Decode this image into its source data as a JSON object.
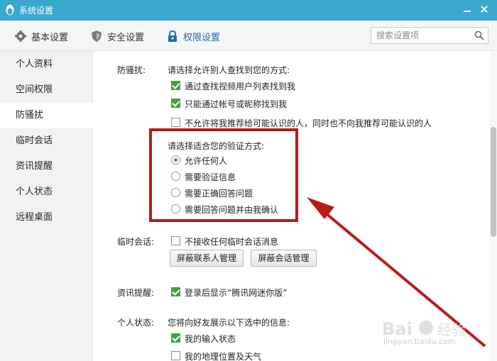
{
  "window": {
    "title": "系统设置"
  },
  "tabs": [
    {
      "label": "基本设置",
      "icon": "gear-icon"
    },
    {
      "label": "安全设置",
      "icon": "shield-icon"
    },
    {
      "label": "权限设置",
      "icon": "lock-icon",
      "active": true
    }
  ],
  "search": {
    "placeholder": "搜索设置项"
  },
  "sidebar": {
    "items": [
      {
        "label": "个人资料"
      },
      {
        "label": "空间权限"
      },
      {
        "label": "防骚扰",
        "active": true
      },
      {
        "label": "临时会话"
      },
      {
        "label": "资讯提醒"
      },
      {
        "label": "个人状态"
      },
      {
        "label": "远程桌面"
      }
    ]
  },
  "anti_harass": {
    "label": "防骚扰:",
    "prompt": "请选择允许别人查找到您的方式:",
    "options": [
      {
        "label": "通过查找视频用户列表找到我",
        "checked": true
      },
      {
        "label": "只能通过帐号或昵称找到我",
        "checked": true
      },
      {
        "label": "不允许将我推荐给可能认识的人，同时也不向我推荐可能认识的人",
        "checked": false
      }
    ],
    "verify_prompt": "请选择适合您的验证方式:",
    "verify_options": [
      {
        "label": "允许任何人",
        "selected": true
      },
      {
        "label": "需要验证信息",
        "selected": false
      },
      {
        "label": "需要正确回答问题",
        "selected": false
      },
      {
        "label": "需要回答问题并由我确认",
        "selected": false
      }
    ]
  },
  "temp_session": {
    "label": "临时会话:",
    "option": {
      "label": "不接收任何临时会话消息",
      "checked": false
    },
    "buttons": [
      "屏蔽联系人管理",
      "屏蔽会话管理"
    ]
  },
  "news": {
    "label": "资讯提醒:",
    "option": {
      "label": "登录后显示“腾讯网迷你版”",
      "checked": true
    }
  },
  "status": {
    "label": "个人状态:",
    "prompt": "您将向好友展示以下选中的信息:",
    "options": [
      {
        "label": "我的输入状态",
        "checked": true
      },
      {
        "label": "我的地理位置及天气",
        "checked": false
      }
    ]
  },
  "colors": {
    "titlebar": "#3aa8cf",
    "check_green": "#41a047",
    "annotation_red": "#b71c1c",
    "active_tab_blue": "#1b6fb6"
  },
  "watermark": {
    "text": "jingyan.baidu.com"
  }
}
